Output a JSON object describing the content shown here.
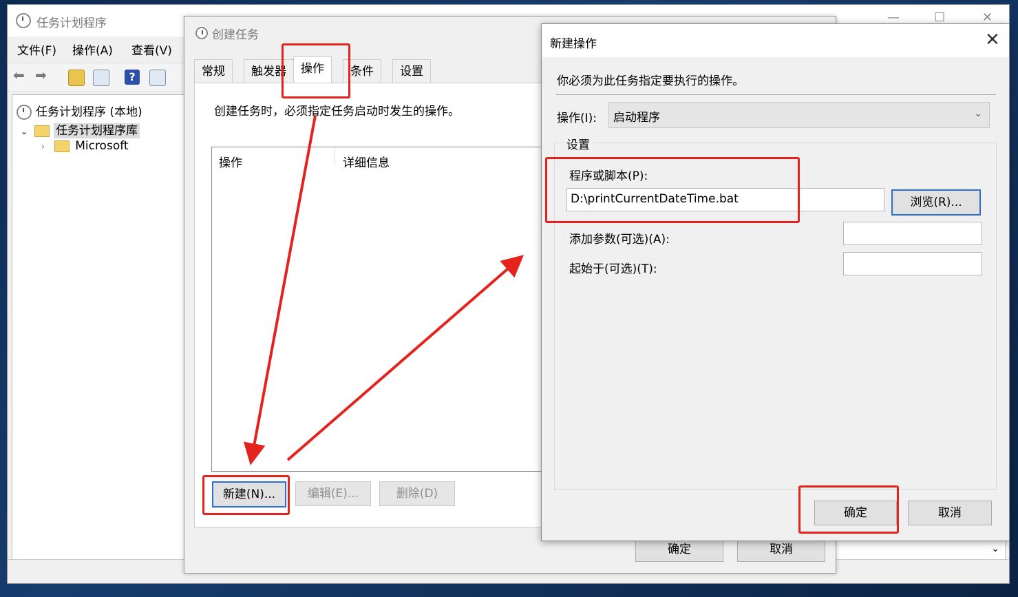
{
  "main_window": {
    "title": "任务计划程序",
    "menu": [
      "文件(F)",
      "操作(A)",
      "查看(V)"
    ],
    "tree": {
      "root": "任务计划程序 (本地)",
      "library": "任务计划程序库",
      "child": "Microsoft"
    }
  },
  "create_task": {
    "title": "创建任务",
    "tabs": [
      "常规",
      "触发器",
      "操作",
      "条件",
      "设置"
    ],
    "active_tab": "操作",
    "description": "创建任务时，必须指定任务启动时发生的操作。",
    "columns": [
      "操作",
      "详细信息"
    ],
    "buttons": {
      "new": "新建(N)...",
      "edit": "编辑(E)...",
      "delete": "删除(D)"
    },
    "ok": "确定",
    "cancel": "取消"
  },
  "new_action": {
    "title": "新建操作",
    "close_icon": "close-icon",
    "prompt": "你必须为此任务指定要执行的操作。",
    "action_label": "操作(I):",
    "action_value": "启动程序",
    "settings_label": "设置",
    "program_label": "程序或脚本(P):",
    "program_value": "D:\\printCurrentDateTime.bat",
    "browse": "浏览(R)...",
    "args_label": "添加参数(可选)(A):",
    "args_value": "",
    "start_in_label": "起始于(可选)(T):",
    "start_in_value": "",
    "ok": "确定",
    "cancel": "取消"
  },
  "annotation_color": "#e5231e"
}
